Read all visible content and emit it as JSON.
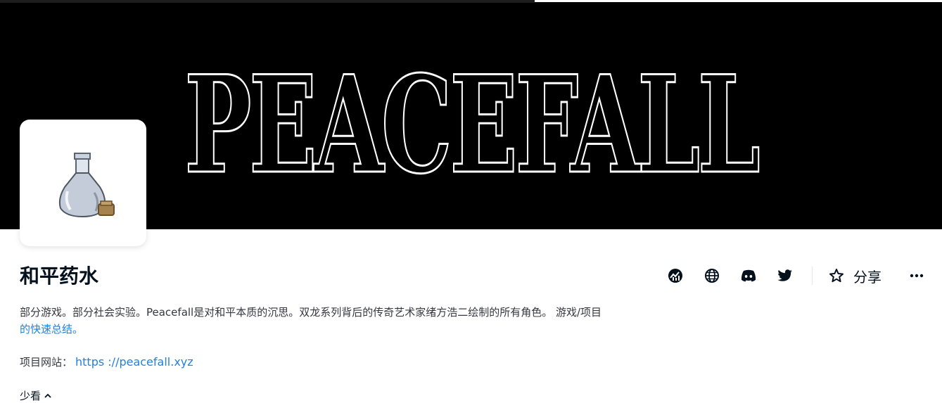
{
  "banner": {
    "title": "PEACEFALL"
  },
  "collection": {
    "name": "和平药水"
  },
  "actions": {
    "items": [
      "activity-icon",
      "globe-icon",
      "discord-icon",
      "twitter-icon",
      "star-icon"
    ],
    "share_label": "分享",
    "more_icon": "more-horizontal-icon"
  },
  "description": {
    "text": "部分游戏。部分社会实验。Peacefall是对和平本质的沉思。双龙系列背后的传奇艺术家绪方浩二绘制的所有角色。 游戏/项目",
    "link_text": "的快速总结。"
  },
  "website": {
    "label": "项目网站：",
    "url": "https ://peacefall.xyz"
  },
  "toggle": {
    "label": "少看"
  },
  "colors": {
    "link": "#2081e2",
    "text": "#353840",
    "banner_bg": "#000000"
  }
}
